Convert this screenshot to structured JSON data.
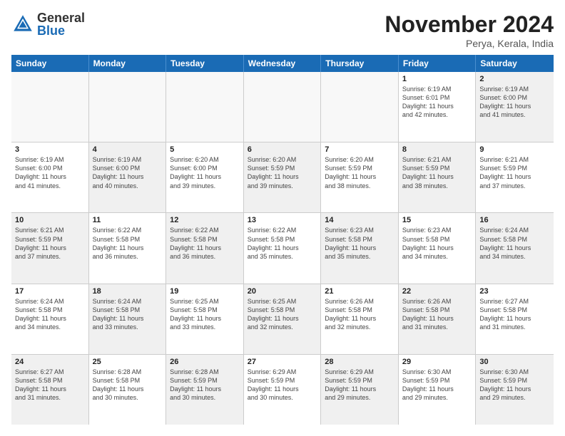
{
  "logo": {
    "general": "General",
    "blue": "Blue"
  },
  "title": "November 2024",
  "location": "Perya, Kerala, India",
  "headers": [
    "Sunday",
    "Monday",
    "Tuesday",
    "Wednesday",
    "Thursday",
    "Friday",
    "Saturday"
  ],
  "weeks": [
    [
      {
        "day": "",
        "info": "",
        "empty": true
      },
      {
        "day": "",
        "info": "",
        "empty": true
      },
      {
        "day": "",
        "info": "",
        "empty": true
      },
      {
        "day": "",
        "info": "",
        "empty": true
      },
      {
        "day": "",
        "info": "",
        "empty": true
      },
      {
        "day": "1",
        "info": "Sunrise: 6:19 AM\nSunset: 6:01 PM\nDaylight: 11 hours\nand 42 minutes.",
        "empty": false
      },
      {
        "day": "2",
        "info": "Sunrise: 6:19 AM\nSunset: 6:00 PM\nDaylight: 11 hours\nand 41 minutes.",
        "empty": false,
        "shaded": true
      }
    ],
    [
      {
        "day": "3",
        "info": "Sunrise: 6:19 AM\nSunset: 6:00 PM\nDaylight: 11 hours\nand 41 minutes.",
        "empty": false
      },
      {
        "day": "4",
        "info": "Sunrise: 6:19 AM\nSunset: 6:00 PM\nDaylight: 11 hours\nand 40 minutes.",
        "empty": false,
        "shaded": true
      },
      {
        "day": "5",
        "info": "Sunrise: 6:20 AM\nSunset: 6:00 PM\nDaylight: 11 hours\nand 39 minutes.",
        "empty": false
      },
      {
        "day": "6",
        "info": "Sunrise: 6:20 AM\nSunset: 5:59 PM\nDaylight: 11 hours\nand 39 minutes.",
        "empty": false,
        "shaded": true
      },
      {
        "day": "7",
        "info": "Sunrise: 6:20 AM\nSunset: 5:59 PM\nDaylight: 11 hours\nand 38 minutes.",
        "empty": false
      },
      {
        "day": "8",
        "info": "Sunrise: 6:21 AM\nSunset: 5:59 PM\nDaylight: 11 hours\nand 38 minutes.",
        "empty": false,
        "shaded": true
      },
      {
        "day": "9",
        "info": "Sunrise: 6:21 AM\nSunset: 5:59 PM\nDaylight: 11 hours\nand 37 minutes.",
        "empty": false
      }
    ],
    [
      {
        "day": "10",
        "info": "Sunrise: 6:21 AM\nSunset: 5:59 PM\nDaylight: 11 hours\nand 37 minutes.",
        "empty": false,
        "shaded": true
      },
      {
        "day": "11",
        "info": "Sunrise: 6:22 AM\nSunset: 5:58 PM\nDaylight: 11 hours\nand 36 minutes.",
        "empty": false
      },
      {
        "day": "12",
        "info": "Sunrise: 6:22 AM\nSunset: 5:58 PM\nDaylight: 11 hours\nand 36 minutes.",
        "empty": false,
        "shaded": true
      },
      {
        "day": "13",
        "info": "Sunrise: 6:22 AM\nSunset: 5:58 PM\nDaylight: 11 hours\nand 35 minutes.",
        "empty": false
      },
      {
        "day": "14",
        "info": "Sunrise: 6:23 AM\nSunset: 5:58 PM\nDaylight: 11 hours\nand 35 minutes.",
        "empty": false,
        "shaded": true
      },
      {
        "day": "15",
        "info": "Sunrise: 6:23 AM\nSunset: 5:58 PM\nDaylight: 11 hours\nand 34 minutes.",
        "empty": false
      },
      {
        "day": "16",
        "info": "Sunrise: 6:24 AM\nSunset: 5:58 PM\nDaylight: 11 hours\nand 34 minutes.",
        "empty": false,
        "shaded": true
      }
    ],
    [
      {
        "day": "17",
        "info": "Sunrise: 6:24 AM\nSunset: 5:58 PM\nDaylight: 11 hours\nand 34 minutes.",
        "empty": false
      },
      {
        "day": "18",
        "info": "Sunrise: 6:24 AM\nSunset: 5:58 PM\nDaylight: 11 hours\nand 33 minutes.",
        "empty": false,
        "shaded": true
      },
      {
        "day": "19",
        "info": "Sunrise: 6:25 AM\nSunset: 5:58 PM\nDaylight: 11 hours\nand 33 minutes.",
        "empty": false
      },
      {
        "day": "20",
        "info": "Sunrise: 6:25 AM\nSunset: 5:58 PM\nDaylight: 11 hours\nand 32 minutes.",
        "empty": false,
        "shaded": true
      },
      {
        "day": "21",
        "info": "Sunrise: 6:26 AM\nSunset: 5:58 PM\nDaylight: 11 hours\nand 32 minutes.",
        "empty": false
      },
      {
        "day": "22",
        "info": "Sunrise: 6:26 AM\nSunset: 5:58 PM\nDaylight: 11 hours\nand 31 minutes.",
        "empty": false,
        "shaded": true
      },
      {
        "day": "23",
        "info": "Sunrise: 6:27 AM\nSunset: 5:58 PM\nDaylight: 11 hours\nand 31 minutes.",
        "empty": false
      }
    ],
    [
      {
        "day": "24",
        "info": "Sunrise: 6:27 AM\nSunset: 5:58 PM\nDaylight: 11 hours\nand 31 minutes.",
        "empty": false,
        "shaded": true
      },
      {
        "day": "25",
        "info": "Sunrise: 6:28 AM\nSunset: 5:58 PM\nDaylight: 11 hours\nand 30 minutes.",
        "empty": false
      },
      {
        "day": "26",
        "info": "Sunrise: 6:28 AM\nSunset: 5:59 PM\nDaylight: 11 hours\nand 30 minutes.",
        "empty": false,
        "shaded": true
      },
      {
        "day": "27",
        "info": "Sunrise: 6:29 AM\nSunset: 5:59 PM\nDaylight: 11 hours\nand 30 minutes.",
        "empty": false
      },
      {
        "day": "28",
        "info": "Sunrise: 6:29 AM\nSunset: 5:59 PM\nDaylight: 11 hours\nand 29 minutes.",
        "empty": false,
        "shaded": true
      },
      {
        "day": "29",
        "info": "Sunrise: 6:30 AM\nSunset: 5:59 PM\nDaylight: 11 hours\nand 29 minutes.",
        "empty": false
      },
      {
        "day": "30",
        "info": "Sunrise: 6:30 AM\nSunset: 5:59 PM\nDaylight: 11 hours\nand 29 minutes.",
        "empty": false,
        "shaded": true
      }
    ]
  ]
}
